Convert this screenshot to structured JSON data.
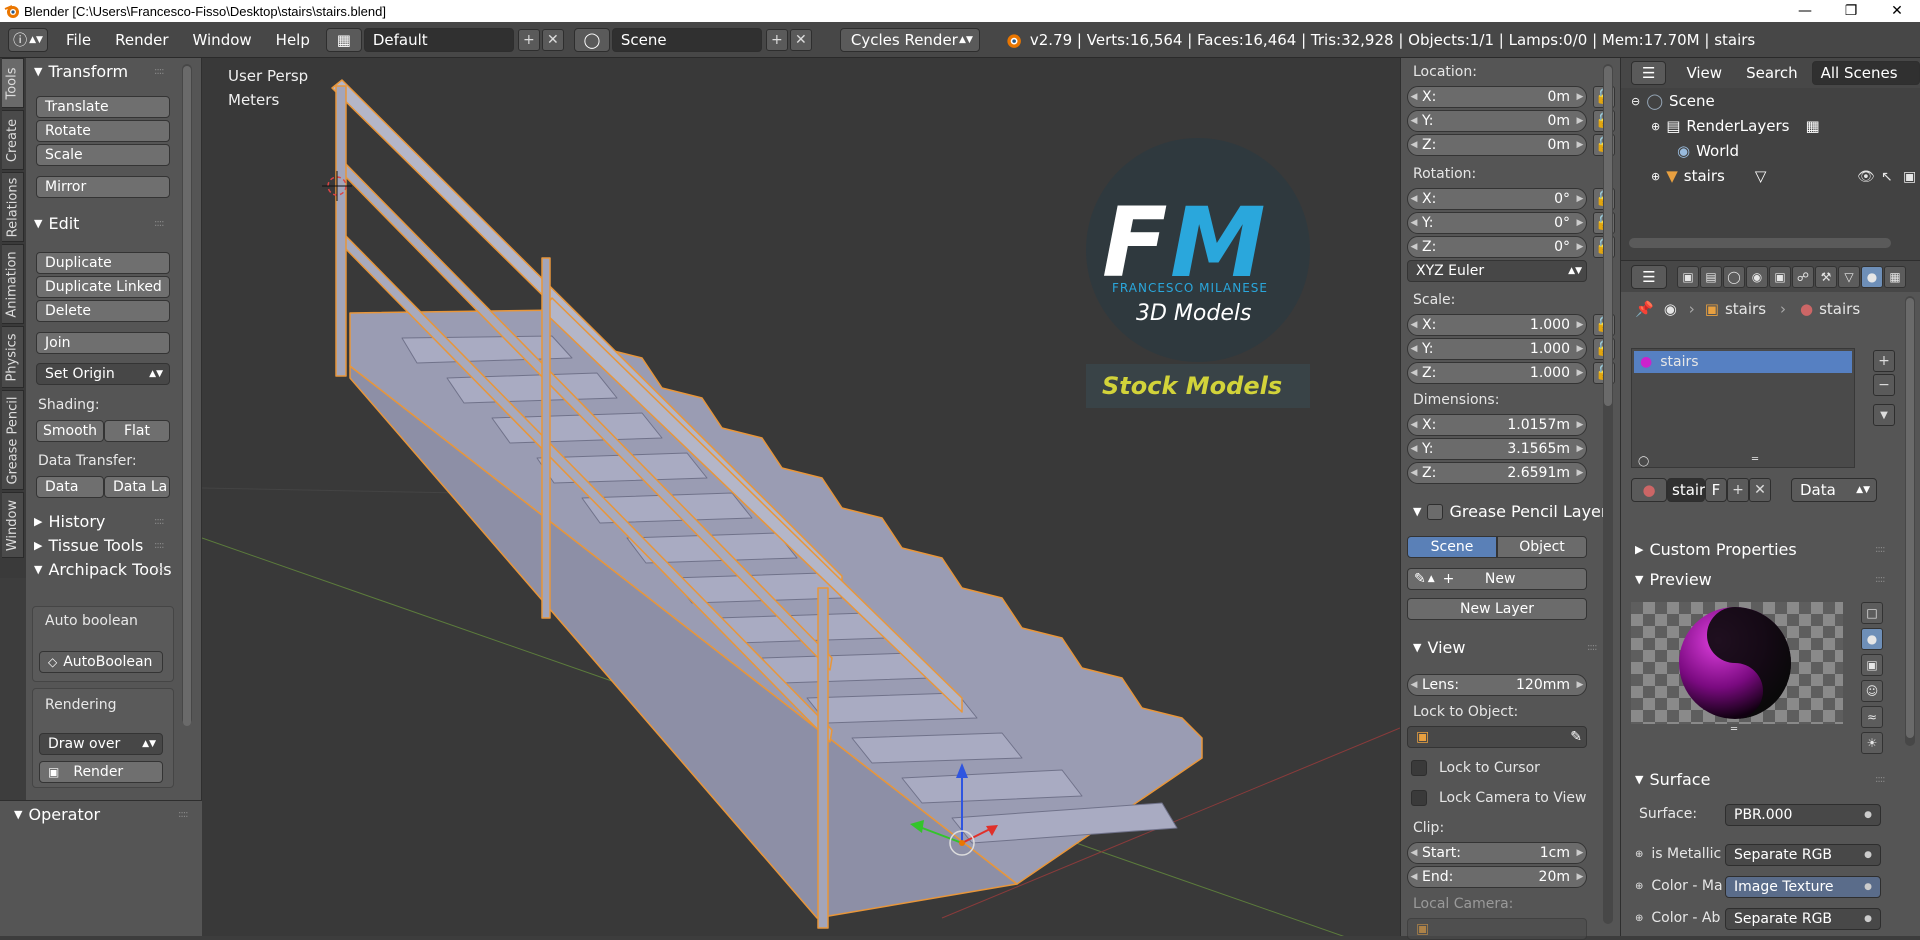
{
  "window": {
    "title": "Blender [C:\\Users\\Francesco-Fisso\\Desktop\\stairs\\stairs.blend]",
    "minimize": "—",
    "maximize": "❐",
    "close": "✕"
  },
  "infobar": {
    "menus": [
      "File",
      "Render",
      "Window",
      "Help"
    ],
    "layout": "Default",
    "scene": "Scene",
    "engine": "Cycles Render",
    "stats": "v2.79 | Verts:16,564 | Faces:16,464 | Tris:32,928 | Objects:1/1 | Lamps:0/0 | Mem:17.70M | stairs"
  },
  "vtabs": [
    "Tools",
    "Create",
    "Relations",
    "Animation",
    "Physics",
    "Grease Pencil",
    "Window"
  ],
  "toolshelf": {
    "transform": {
      "title": "Transform",
      "buttons": [
        "Translate",
        "Rotate",
        "Scale",
        "Mirror"
      ]
    },
    "edit": {
      "title": "Edit",
      "buttons": [
        "Duplicate",
        "Duplicate Linked",
        "Delete",
        "Join"
      ],
      "set_origin": "Set Origin",
      "shading_label": "Shading:",
      "smooth": "Smooth",
      "flat": "Flat",
      "data_transfer_label": "Data Transfer:",
      "data": "Data",
      "data_layers": "Data La"
    },
    "history": "History",
    "tissue_tools": "Tissue Tools",
    "archipack": {
      "title": "Archipack Tools",
      "auto_boolean_label": "Auto boolean",
      "auto_boolean_btn": "AutoBoolean",
      "rendering_label": "Rendering",
      "draw_over": "Draw over",
      "render": "Render"
    }
  },
  "operator": {
    "title": "Operator"
  },
  "viewport": {
    "view_name": "User Persp",
    "units": "Meters",
    "logo": {
      "letters": "FM",
      "subtitle": "FRANCESCO MILANESE",
      "tagline": "3D Models",
      "banner": "Stock Models"
    }
  },
  "npanel": {
    "location_label": "Location:",
    "location": [
      {
        "axis": "X:",
        "value": "0m"
      },
      {
        "axis": "Y:",
        "value": "0m"
      },
      {
        "axis": "Z:",
        "value": "0m"
      }
    ],
    "rotation_label": "Rotation:",
    "rotation": [
      {
        "axis": "X:",
        "value": "0°"
      },
      {
        "axis": "Y:",
        "value": "0°"
      },
      {
        "axis": "Z:",
        "value": "0°"
      }
    ],
    "rotation_mode": "XYZ Euler",
    "scale_label": "Scale:",
    "scale": [
      {
        "axis": "X:",
        "value": "1.000"
      },
      {
        "axis": "Y:",
        "value": "1.000"
      },
      {
        "axis": "Z:",
        "value": "1.000"
      }
    ],
    "dimensions_label": "Dimensions:",
    "dimensions": [
      {
        "axis": "X:",
        "value": "1.0157m"
      },
      {
        "axis": "Y:",
        "value": "3.1565m"
      },
      {
        "axis": "Z:",
        "value": "2.6591m"
      }
    ],
    "grease_pencil": {
      "title": "Grease Pencil Layer",
      "scene": "Scene",
      "object": "Object",
      "new": "New",
      "new_layer": "New Layer"
    },
    "view": {
      "title": "View",
      "lens_label": "Lens:",
      "lens_value": "120mm",
      "lock_to_object": "Lock to Object:",
      "lock_to_cursor": "Lock to Cursor",
      "lock_camera": "Lock Camera to View",
      "clip_label": "Clip:",
      "clip_start_label": "Start:",
      "clip_start": "1cm",
      "clip_end_label": "End:",
      "clip_end": "20m",
      "local_camera": "Local Camera:"
    }
  },
  "outliner": {
    "view": "View",
    "search": "Search",
    "filter": "All Scenes",
    "items": [
      "Scene",
      "RenderLayers",
      "World",
      "stairs"
    ]
  },
  "properties": {
    "breadcrumb": [
      "stairs",
      "stairs"
    ],
    "material_slot": "stairs",
    "material_name": "stairs",
    "material_f": "F",
    "link": "Data",
    "custom_properties": "Custom Properties",
    "preview": "Preview",
    "surface_title": "Surface",
    "surface_label": "Surface:",
    "surface_value": "PBR.000",
    "inputs": [
      {
        "label": "is Metallic",
        "value": "Separate RGB"
      },
      {
        "label": "Color - Ma",
        "value": "Image Texture"
      },
      {
        "label": "Color - Ab",
        "value": "Separate RGB"
      }
    ]
  }
}
